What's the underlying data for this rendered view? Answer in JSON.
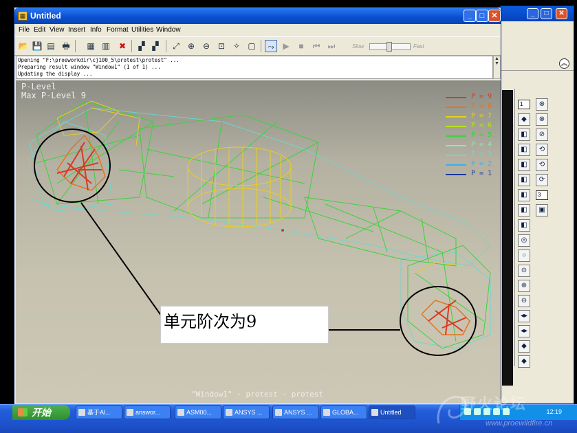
{
  "window": {
    "title": "Untitled"
  },
  "menu": [
    "File",
    "Edit",
    "View",
    "Insert",
    "Info",
    "Format",
    "Utilities",
    "Window"
  ],
  "toolbar": {
    "slow_label": "Slow",
    "fast_label": "Fast"
  },
  "messages": [
    "Opening \"F:\\proeworkdir\\cj100_5\\protest\\protest\" ...",
    "Preparing result window \"Window1\" (1 of 1) ...",
    "Updating the display ..."
  ],
  "viewport": {
    "title_line1": "P-Level",
    "title_line2": "Max P-Level 9",
    "footer": "\"Window1\" - protest - protest"
  },
  "legend": [
    {
      "label": "P = 9",
      "color": "#d83a22"
    },
    {
      "label": "P = 8",
      "color": "#e8721c"
    },
    {
      "label": "P = 7",
      "color": "#e8d01c"
    },
    {
      "label": "P = 6",
      "color": "#b8e21c"
    },
    {
      "label": "P = 5",
      "color": "#3cd23c"
    },
    {
      "label": "P = 4",
      "color": "#8ee8b4"
    },
    {
      "label": "P = 3",
      "color": "#6ad8d0"
    },
    {
      "label": "P = 2",
      "color": "#3ab0e8"
    },
    {
      "label": "P = 1",
      "color": "#1a3a9a"
    }
  ],
  "annotation": {
    "text": "单元阶次为9"
  },
  "side_panel": {
    "select1": "1",
    "select2": "3"
  },
  "taskbar": {
    "start_label": "开始",
    "tasks": [
      "基于Al...",
      "answor...",
      "ASM00...",
      "ANSYS ...",
      "ANSYS ...",
      "GLOBA...",
      "Untitled"
    ],
    "clock": "12:19"
  },
  "watermark": {
    "text": "野火论坛",
    "url": "www.proewildfire.cn"
  }
}
